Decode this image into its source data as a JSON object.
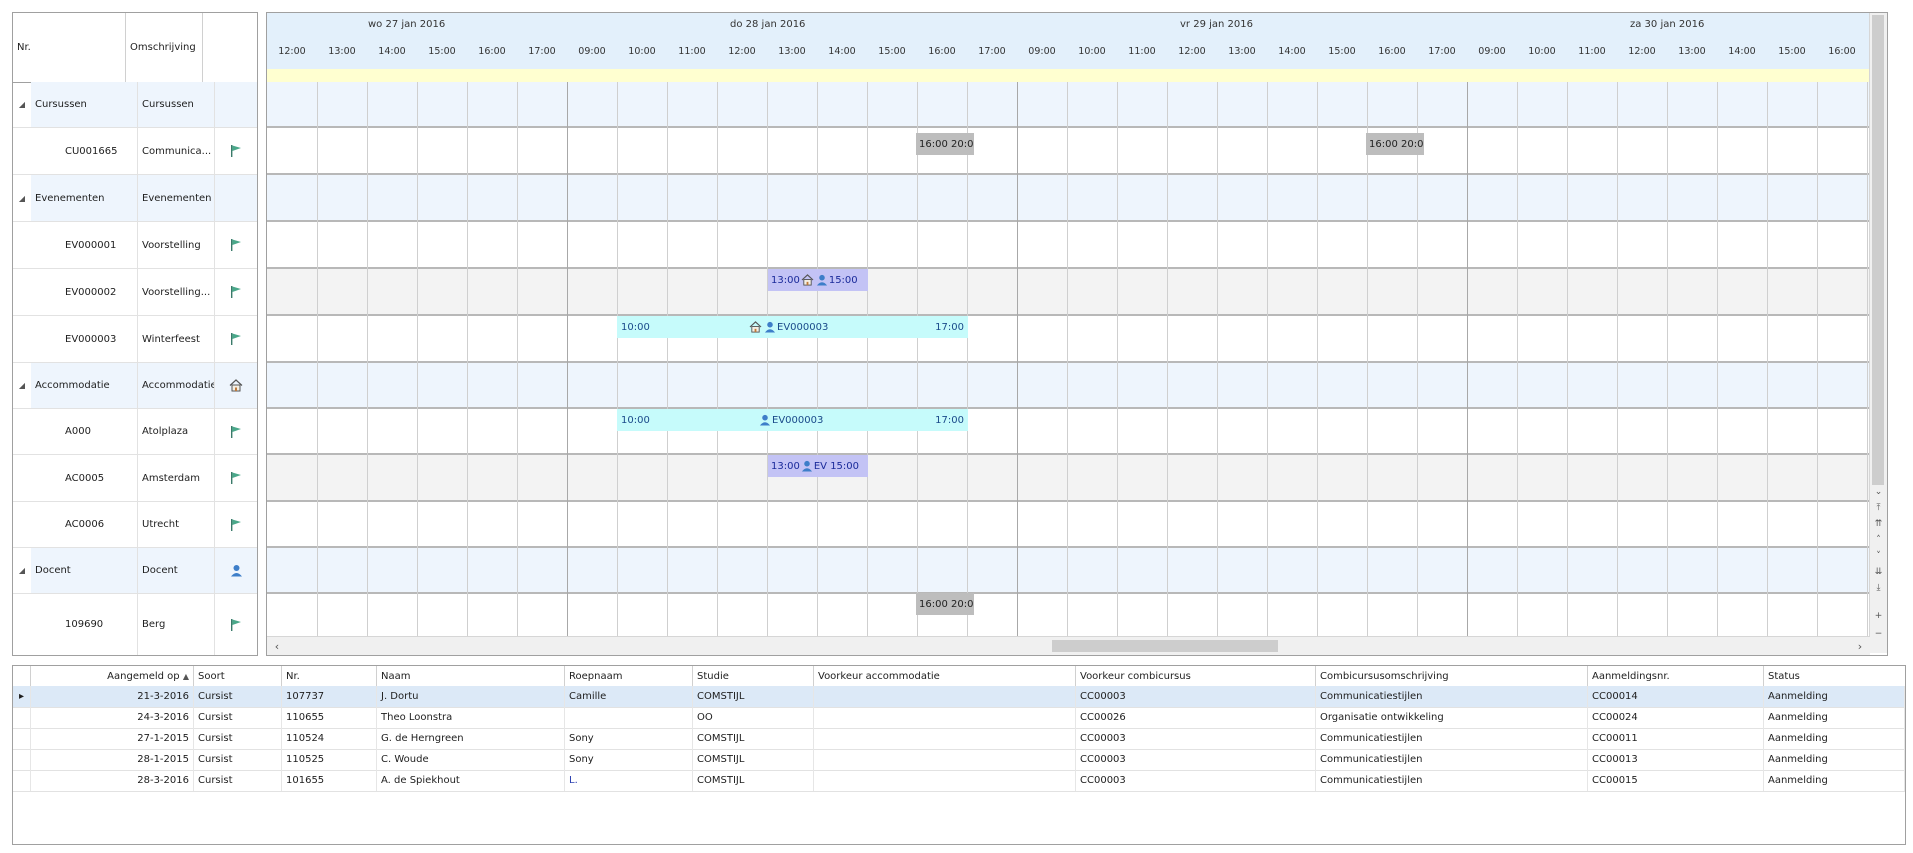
{
  "tree": {
    "headers": {
      "nr": "Nr.",
      "omschrijving": "Omschrijving"
    },
    "rows": [
      {
        "type": "group",
        "nr": "Cursussen",
        "om": "Cursussen",
        "icon": ""
      },
      {
        "type": "child",
        "nr": "CU001665",
        "om": "Communica...",
        "icon": "flag-icon"
      },
      {
        "type": "group",
        "nr": "Evenementen",
        "om": "Evenementen",
        "icon": ""
      },
      {
        "type": "child",
        "nr": "EV000001",
        "om": "Voorstelling",
        "icon": "flag-icon"
      },
      {
        "type": "child",
        "nr": "EV000002",
        "om": "Voorstelling...",
        "icon": "flag-icon"
      },
      {
        "type": "child",
        "nr": "EV000003",
        "om": "Winterfeest",
        "icon": "flag-icon"
      },
      {
        "type": "group",
        "nr": "Accommodatie",
        "om": "Accommodatie",
        "icon": "house-icon"
      },
      {
        "type": "child",
        "nr": "A000",
        "om": "Atolplaza",
        "icon": "flag-icon"
      },
      {
        "type": "child",
        "nr": "AC0005",
        "om": "Amsterdam",
        "icon": "flag-icon"
      },
      {
        "type": "child",
        "nr": "AC0006",
        "om": "Utrecht",
        "icon": "flag-icon"
      },
      {
        "type": "group",
        "nr": "Docent",
        "om": "Docent",
        "icon": "person-icon"
      },
      {
        "type": "child",
        "nr": "109690",
        "om": "Berg",
        "icon": "flag-icon"
      }
    ]
  },
  "scheduler": {
    "days": [
      {
        "label": "wo 27 jan 2016"
      },
      {
        "label": "do 28 jan 2016"
      },
      {
        "label": "vr 29 jan 2016"
      },
      {
        "label": "za 30 jan 2016"
      }
    ],
    "hours": [
      "12:00",
      "13:00",
      "14:00",
      "15:00",
      "16:00",
      "17:00",
      "09:00",
      "10:00",
      "11:00",
      "12:00",
      "13:00",
      "14:00",
      "15:00",
      "16:00",
      "17:00",
      "09:00",
      "10:00",
      "11:00",
      "12:00",
      "13:00",
      "14:00",
      "15:00",
      "16:00",
      "17:00",
      "09:00",
      "10:00",
      "11:00",
      "12:00",
      "13:00",
      "14:00",
      "15:00",
      "16:00"
    ],
    "appointments": {
      "cu_1": "16:00 20:0",
      "cu_2": "16:00 20:0",
      "ev2_start": "13:00",
      "ev2_end": "15:00",
      "ev3_start": "10:00",
      "ev3_label": "EV000003",
      "ev3_end": "17:00",
      "a000_start": "10:00",
      "a000_label": "EV000003",
      "a000_end": "17:00",
      "ac5_start": "13:00",
      "ac5_label": "EV",
      "ac5_end": "15:00",
      "docent_1": "16:00 20:0"
    }
  },
  "table": {
    "columns": [
      "Aangemeld op",
      "Soort",
      "Nr.",
      "Naam",
      "Roepnaam",
      "Studie",
      "Voorkeur accommodatie",
      "Voorkeur combicursus",
      "Combicursusomschrijving",
      "Aanmeldingsnr.",
      "Status"
    ],
    "sort_indicator": "▲",
    "rows": [
      [
        "21-3-2016",
        "Cursist",
        "107737",
        "J. Dortu",
        "Camille",
        "COMSTIJL",
        "",
        "CC00003",
        "Communicatiestijlen",
        "CC00014",
        "Aanmelding"
      ],
      [
        "24-3-2016",
        "Cursist",
        "110655",
        "Theo Loonstra",
        "",
        "OO",
        "",
        "CC00026",
        "Organisatie ontwikkeling",
        "CC00024",
        "Aanmelding"
      ],
      [
        "27-1-2015",
        "Cursist",
        "110524",
        "G. de Herngreen",
        "Sony",
        "COMSTIJL",
        "",
        "CC00003",
        "Communicatiestijlen",
        "CC00011",
        "Aanmelding"
      ],
      [
        "28-1-2015",
        "Cursist",
        "110525",
        "C. Woude",
        "Sony",
        "COMSTIJL",
        "",
        "CC00003",
        "Communicatiestijlen",
        "CC00013",
        "Aanmelding"
      ],
      [
        "28-3-2016",
        "Cursist",
        "101655",
        "A. de Spiekhout",
        "L.",
        "COMSTIJL",
        "",
        "CC00003",
        "Communicatiestijlen",
        "CC00015",
        "Aanmelding"
      ]
    ]
  }
}
